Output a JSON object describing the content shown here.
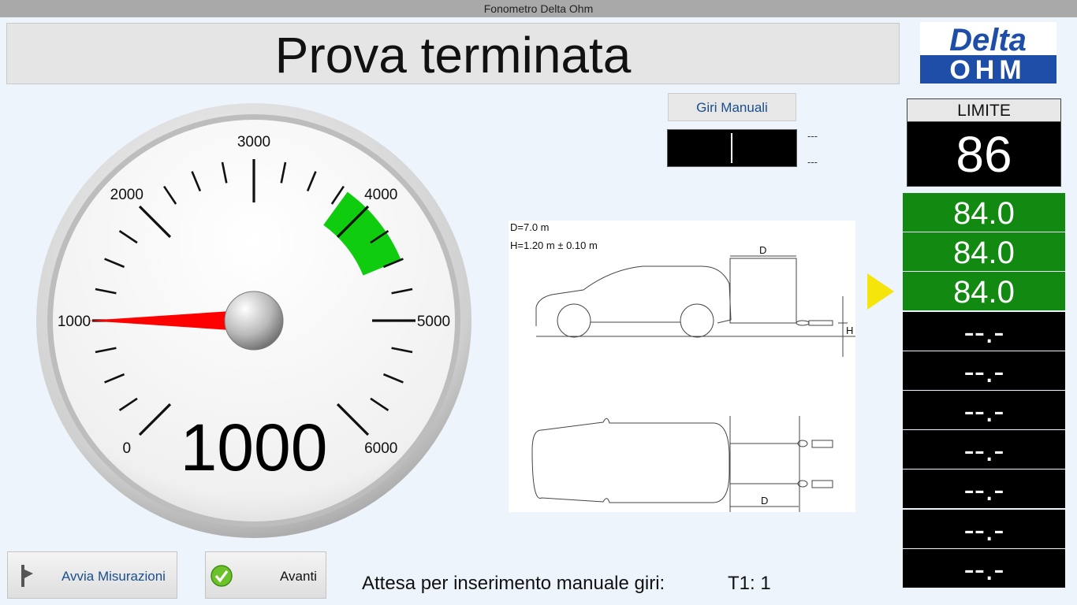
{
  "window": {
    "title": "Fonometro Delta Ohm"
  },
  "banner": {
    "status": "Prova terminata"
  },
  "logo": {
    "line1": "Delta",
    "line2": "OHM"
  },
  "gauge": {
    "min": 0,
    "max": 6000,
    "tick_labels": [
      "0",
      "1000",
      "2000",
      "3000",
      "4000",
      "5000",
      "6000"
    ],
    "needle_value": 1000,
    "green_zone": [
      3800,
      4500
    ],
    "readout": "1000"
  },
  "manual_rpm": {
    "button_label": "Giri Manuali",
    "input_value": "",
    "dash_top": "---",
    "dash_bottom": "---"
  },
  "diagram": {
    "label_d": "D=7.0 m",
    "label_h": "H=1.20 m ± 0.10 m",
    "dim_d": "D",
    "dim_h": "H"
  },
  "limit": {
    "title": "LIMITE",
    "value": "86"
  },
  "results": [
    {
      "value": "84.0",
      "status": "ok"
    },
    {
      "value": "84.0",
      "status": "ok"
    },
    {
      "value": "84.0",
      "status": "ok"
    },
    {
      "value": "--.-",
      "status": "empty"
    },
    {
      "value": "--.-",
      "status": "empty"
    },
    {
      "value": "--.-",
      "status": "empty"
    },
    {
      "value": "--.-",
      "status": "empty"
    },
    {
      "value": "--.-",
      "status": "empty"
    },
    {
      "value": "--.-",
      "status": "empty"
    },
    {
      "value": "--.-",
      "status": "empty"
    }
  ],
  "current_result_index": 2,
  "buttons": {
    "start_label": "Avvia Misurazioni",
    "next_label": "Avanti"
  },
  "footer": {
    "message": "Attesa per inserimento manuale giri:",
    "t1": "T1: 1"
  },
  "colors": {
    "ok": "#128a12",
    "empty": "#000000",
    "arrow": "#f5e50a",
    "needle": "#ff0000",
    "zone": "#0fcc0f",
    "logo": "#1f4ea8"
  }
}
